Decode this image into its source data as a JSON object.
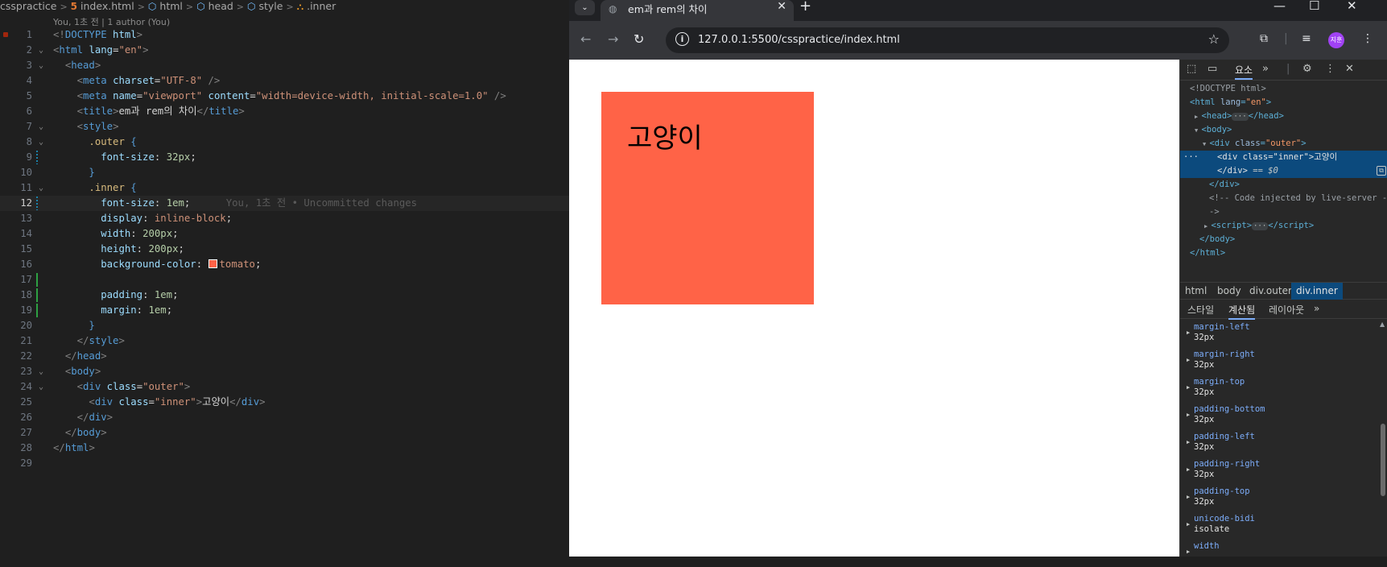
{
  "editor": {
    "breadcrumb": [
      "csspractice",
      "index.html",
      "html",
      "head",
      "style",
      ".inner"
    ],
    "blame": "You, 1초 전 | 1 author (You)",
    "inline_blame": "You, 1초 전 • Uncommitted changes",
    "lines": [
      {
        "n": "1",
        "code": [
          [
            "t-p",
            "<!"
          ],
          [
            "t-tag",
            "DOCTYPE"
          ],
          [
            "t-txt",
            " "
          ],
          [
            "t-attr",
            "html"
          ],
          [
            "t-p",
            ">"
          ]
        ]
      },
      {
        "n": "2",
        "code": [
          [
            "t-p",
            "<"
          ],
          [
            "t-tag",
            "html"
          ],
          [
            "t-txt",
            " "
          ],
          [
            "t-attr",
            "lang"
          ],
          [
            "t-txt",
            "="
          ],
          [
            "t-str",
            "\"en\""
          ],
          [
            "t-p",
            ">"
          ]
        ]
      },
      {
        "n": "3",
        "code": [
          [
            "t-txt",
            "  "
          ],
          [
            "t-p",
            "<"
          ],
          [
            "t-tag",
            "head"
          ],
          [
            "t-p",
            ">"
          ]
        ]
      },
      {
        "n": "4",
        "code": [
          [
            "t-txt",
            "    "
          ],
          [
            "t-p",
            "<"
          ],
          [
            "t-tag",
            "meta"
          ],
          [
            "t-txt",
            " "
          ],
          [
            "t-attr",
            "charset"
          ],
          [
            "t-txt",
            "="
          ],
          [
            "t-str",
            "\"UTF-8\""
          ],
          [
            "t-txt",
            " "
          ],
          [
            "t-p",
            "/>"
          ]
        ]
      },
      {
        "n": "5",
        "code": [
          [
            "t-txt",
            "    "
          ],
          [
            "t-p",
            "<"
          ],
          [
            "t-tag",
            "meta"
          ],
          [
            "t-txt",
            " "
          ],
          [
            "t-attr",
            "name"
          ],
          [
            "t-txt",
            "="
          ],
          [
            "t-str",
            "\"viewport\""
          ],
          [
            "t-txt",
            " "
          ],
          [
            "t-attr",
            "content"
          ],
          [
            "t-txt",
            "="
          ],
          [
            "t-str",
            "\"width=device-width, initial-scale=1.0\""
          ],
          [
            "t-txt",
            " "
          ],
          [
            "t-p",
            "/>"
          ]
        ]
      },
      {
        "n": "6",
        "code": [
          [
            "t-txt",
            "    "
          ],
          [
            "t-p",
            "<"
          ],
          [
            "t-tag",
            "title"
          ],
          [
            "t-p",
            ">"
          ],
          [
            "t-txt",
            "em과 rem의 차이"
          ],
          [
            "t-p",
            "</"
          ],
          [
            "t-tag",
            "title"
          ],
          [
            "t-p",
            ">"
          ]
        ]
      },
      {
        "n": "7",
        "code": [
          [
            "t-txt",
            "    "
          ],
          [
            "t-p",
            "<"
          ],
          [
            "t-tag",
            "style"
          ],
          [
            "t-p",
            ">"
          ]
        ]
      },
      {
        "n": "8",
        "code": [
          [
            "t-txt",
            "      "
          ],
          [
            "t-sel",
            ".outer"
          ],
          [
            "t-txt",
            " "
          ],
          [
            "t-br",
            "{"
          ]
        ]
      },
      {
        "n": "9",
        "code": [
          [
            "t-txt",
            "        "
          ],
          [
            "t-prop",
            "font-size"
          ],
          [
            "t-txt",
            ": "
          ],
          [
            "t-num",
            "32"
          ],
          [
            "t-unit",
            "px"
          ],
          [
            "t-txt",
            ";"
          ]
        ]
      },
      {
        "n": "10",
        "code": [
          [
            "t-txt",
            "      "
          ],
          [
            "t-br",
            "}"
          ]
        ]
      },
      {
        "n": "11",
        "code": [
          [
            "t-txt",
            "      "
          ],
          [
            "t-sel",
            ".inner"
          ],
          [
            "t-txt",
            " "
          ],
          [
            "t-br",
            "{"
          ]
        ]
      },
      {
        "n": "12",
        "code": [
          [
            "t-txt",
            "        "
          ],
          [
            "t-prop",
            "font-size"
          ],
          [
            "t-txt",
            ": "
          ],
          [
            "t-num",
            "1"
          ],
          [
            "t-unit",
            "em"
          ],
          [
            "t-txt",
            ";"
          ]
        ]
      },
      {
        "n": "13",
        "code": [
          [
            "t-txt",
            "        "
          ],
          [
            "t-prop",
            "display"
          ],
          [
            "t-txt",
            ": "
          ],
          [
            "t-val",
            "inline-block"
          ],
          [
            "t-txt",
            ";"
          ]
        ]
      },
      {
        "n": "14",
        "code": [
          [
            "t-txt",
            "        "
          ],
          [
            "t-prop",
            "width"
          ],
          [
            "t-txt",
            ": "
          ],
          [
            "t-num",
            "200"
          ],
          [
            "t-unit",
            "px"
          ],
          [
            "t-txt",
            ";"
          ]
        ]
      },
      {
        "n": "15",
        "code": [
          [
            "t-txt",
            "        "
          ],
          [
            "t-prop",
            "height"
          ],
          [
            "t-txt",
            ": "
          ],
          [
            "t-num",
            "200"
          ],
          [
            "t-unit",
            "px"
          ],
          [
            "t-txt",
            ";"
          ]
        ]
      },
      {
        "n": "16",
        "code": [
          [
            "t-txt",
            "        "
          ],
          [
            "t-prop",
            "background-color"
          ],
          [
            "t-txt",
            ": "
          ],
          [
            "swatch",
            ""
          ],
          [
            "t-val",
            "tomato"
          ],
          [
            "t-txt",
            ";"
          ]
        ]
      },
      {
        "n": "17",
        "code": []
      },
      {
        "n": "18",
        "code": [
          [
            "t-txt",
            "        "
          ],
          [
            "t-prop",
            "padding"
          ],
          [
            "t-txt",
            ": "
          ],
          [
            "t-num",
            "1"
          ],
          [
            "t-unit",
            "em"
          ],
          [
            "t-txt",
            ";"
          ]
        ]
      },
      {
        "n": "19",
        "code": [
          [
            "t-txt",
            "        "
          ],
          [
            "t-prop",
            "margin"
          ],
          [
            "t-txt",
            ": "
          ],
          [
            "t-num",
            "1"
          ],
          [
            "t-unit",
            "em"
          ],
          [
            "t-txt",
            ";"
          ]
        ]
      },
      {
        "n": "20",
        "code": [
          [
            "t-txt",
            "      "
          ],
          [
            "t-br",
            "}"
          ]
        ]
      },
      {
        "n": "21",
        "code": [
          [
            "t-txt",
            "    "
          ],
          [
            "t-p",
            "</"
          ],
          [
            "t-tag",
            "style"
          ],
          [
            "t-p",
            ">"
          ]
        ]
      },
      {
        "n": "22",
        "code": [
          [
            "t-txt",
            "  "
          ],
          [
            "t-p",
            "</"
          ],
          [
            "t-tag",
            "head"
          ],
          [
            "t-p",
            ">"
          ]
        ]
      },
      {
        "n": "23",
        "code": [
          [
            "t-txt",
            "  "
          ],
          [
            "t-p",
            "<"
          ],
          [
            "t-tag",
            "body"
          ],
          [
            "t-p",
            ">"
          ]
        ]
      },
      {
        "n": "24",
        "code": [
          [
            "t-txt",
            "    "
          ],
          [
            "t-p",
            "<"
          ],
          [
            "t-tag",
            "div"
          ],
          [
            "t-txt",
            " "
          ],
          [
            "t-attr",
            "class"
          ],
          [
            "t-txt",
            "="
          ],
          [
            "t-str",
            "\"outer\""
          ],
          [
            "t-p",
            ">"
          ]
        ]
      },
      {
        "n": "25",
        "code": [
          [
            "t-txt",
            "      "
          ],
          [
            "t-p",
            "<"
          ],
          [
            "t-tag",
            "div"
          ],
          [
            "t-txt",
            " "
          ],
          [
            "t-attr",
            "class"
          ],
          [
            "t-txt",
            "="
          ],
          [
            "t-str",
            "\"inner\""
          ],
          [
            "t-p",
            ">"
          ],
          [
            "t-txt",
            "고양이"
          ],
          [
            "t-p",
            "</"
          ],
          [
            "t-tag",
            "div"
          ],
          [
            "t-p",
            ">"
          ]
        ]
      },
      {
        "n": "26",
        "code": [
          [
            "t-txt",
            "    "
          ],
          [
            "t-p",
            "</"
          ],
          [
            "t-tag",
            "div"
          ],
          [
            "t-p",
            ">"
          ]
        ]
      },
      {
        "n": "27",
        "code": [
          [
            "t-txt",
            "  "
          ],
          [
            "t-p",
            "</"
          ],
          [
            "t-tag",
            "body"
          ],
          [
            "t-p",
            ">"
          ]
        ]
      },
      {
        "n": "28",
        "code": [
          [
            "t-p",
            "</"
          ],
          [
            "t-tag",
            "html"
          ],
          [
            "t-p",
            ">"
          ]
        ]
      },
      {
        "n": "29",
        "code": []
      }
    ]
  },
  "browser": {
    "tab_title": "em과 rem의 차이",
    "url": "127.0.0.1:5500/csspractice/index.html",
    "avatar_text": "지훈",
    "page_text": "고양이",
    "page_box_color": "#ff6347"
  },
  "devtools": {
    "elements_tab": "요소",
    "dom": {
      "doctype": "<!DOCTYPE html>",
      "comment": "<!-- Code injected by live-server -",
      "comment_end": "->",
      "inner_text": "고양이",
      "eq": "== $0"
    },
    "breadcrumb": [
      "html",
      "body",
      "div.outer",
      "div.inner"
    ],
    "subtabs": [
      "스타일",
      "계산됨",
      "레이아웃"
    ],
    "computed": [
      {
        "name": "margin-left",
        "value": "32px"
      },
      {
        "name": "margin-right",
        "value": "32px"
      },
      {
        "name": "margin-top",
        "value": "32px"
      },
      {
        "name": "padding-bottom",
        "value": "32px"
      },
      {
        "name": "padding-left",
        "value": "32px"
      },
      {
        "name": "padding-right",
        "value": "32px"
      },
      {
        "name": "padding-top",
        "value": "32px"
      },
      {
        "name": "unicode-bidi",
        "value": "isolate"
      },
      {
        "name": "width",
        "value": ""
      }
    ]
  }
}
